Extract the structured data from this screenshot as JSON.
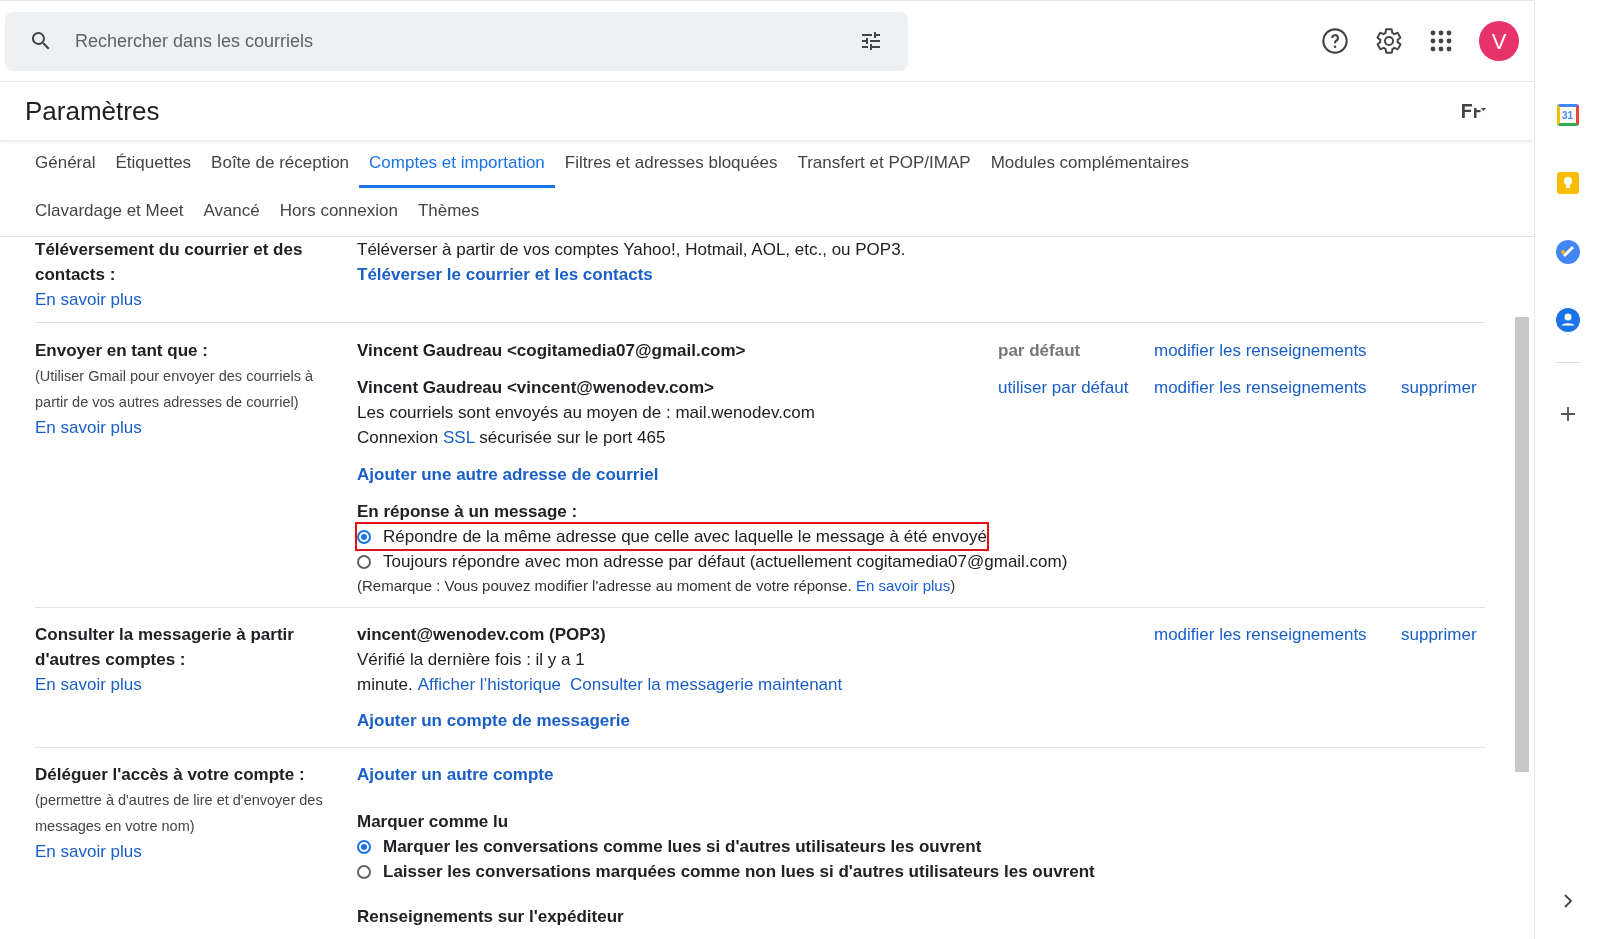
{
  "search": {
    "placeholder": "Rechercher dans les courriels"
  },
  "avatar": {
    "letter": "V"
  },
  "page_title": "Paramètres",
  "tabs": [
    {
      "label": "Général",
      "selected": false
    },
    {
      "label": "Étiquettes",
      "selected": false
    },
    {
      "label": "Boîte de réception",
      "selected": false
    },
    {
      "label": "Comptes et importation",
      "selected": true
    },
    {
      "label": "Filtres et adresses bloquées",
      "selected": false
    },
    {
      "label": "Transfert et POP/IMAP",
      "selected": false
    },
    {
      "label": "Modules complémentaires",
      "selected": false
    },
    {
      "label": "Clavardage et Meet",
      "selected": false
    },
    {
      "label": "Avancé",
      "selected": false
    },
    {
      "label": "Hors connexion",
      "selected": false
    },
    {
      "label": "Thèmes",
      "selected": false
    }
  ],
  "import_section": {
    "label": "Téléversement du courrier et des contacts :",
    "learn_more": "En savoir plus",
    "description": "Téléverser à partir de vos comptes Yahoo!, Hotmail, AOL, etc., ou POP3.",
    "action_link": "Téléverser le courrier et les contacts"
  },
  "send_as": {
    "label": "Envoyer en tant que :",
    "note": "(Utiliser Gmail pour envoyer des courriels à partir de vos autres adresses de courriel)",
    "learn_more": "En savoir plus",
    "accounts": [
      {
        "address": "Vincent Gaudreau <cogitamedia07@gmail.com>",
        "actions": [
          {
            "kind": "status",
            "text": "par défaut"
          },
          {
            "kind": "link",
            "text": "modifier les renseignements"
          }
        ]
      },
      {
        "address": "Vincent Gaudreau <vincent@wenodev.com>",
        "actions": [
          {
            "kind": "link",
            "text": "utiliser par défaut"
          },
          {
            "kind": "link",
            "text": "modifier les renseignements"
          },
          {
            "kind": "link",
            "text": "supprimer"
          }
        ],
        "server_line": "Les courriels sont envoyés au moyen de : mail.wenodev.com",
        "security_line": {
          "before": "Connexion",
          "link": "SSL",
          "after": "sécurisée sur le port 465"
        }
      }
    ],
    "add_link": "Ajouter une autre adresse de courriel",
    "reply_heading": "En réponse à un message :",
    "reply_options": [
      {
        "label": "Répondre de la même adresse que celle avec laquelle le message à été envoyé",
        "selected": true,
        "highlighted": true
      },
      {
        "label": "Toujours répondre avec mon adresse par défaut (actuellement cogitamedia07@gmail.com)",
        "selected": false,
        "highlighted": false
      }
    ],
    "reply_note": {
      "text": "(Remarque : Vous pouvez modifier l'adresse au moment de votre réponse.",
      "link": "En savoir plus",
      "close": ")"
    }
  },
  "check_mail": {
    "label": "Consulter la messagerie à partir d'autres comptes :",
    "learn_more": "En savoir plus",
    "account": "vincent@wenodev.com (POP3)",
    "checked_line": "Vérifié la dernière fois : il y a 1",
    "checked_line_end": "minute.",
    "links": [
      "Afficher l’historique",
      "Consulter la messagerie maintenant"
    ],
    "actions": [
      "modifier les renseignements",
      "supprimer"
    ],
    "add_link": "Ajouter un compte de messagerie"
  },
  "delegate": {
    "label": "Déléguer l'accès à votre compte :",
    "note": "(permettre à d'autres de lire et d'envoyer des messages en votre nom)",
    "learn_more": "En savoir plus",
    "add_link": "Ajouter un autre compte",
    "mark_heading": "Marquer comme lu",
    "mark_options": [
      {
        "label": "Marquer les conversations comme lues si d'autres utilisateurs les ouvrent",
        "selected": true
      },
      {
        "label": "Laisser les conversations marquées comme non lues si d'autres utilisateurs les ouvrent",
        "selected": false
      }
    ],
    "sender_heading": "Renseignements sur l'expéditeur"
  },
  "side_panel": {
    "calendar_day": "31"
  }
}
